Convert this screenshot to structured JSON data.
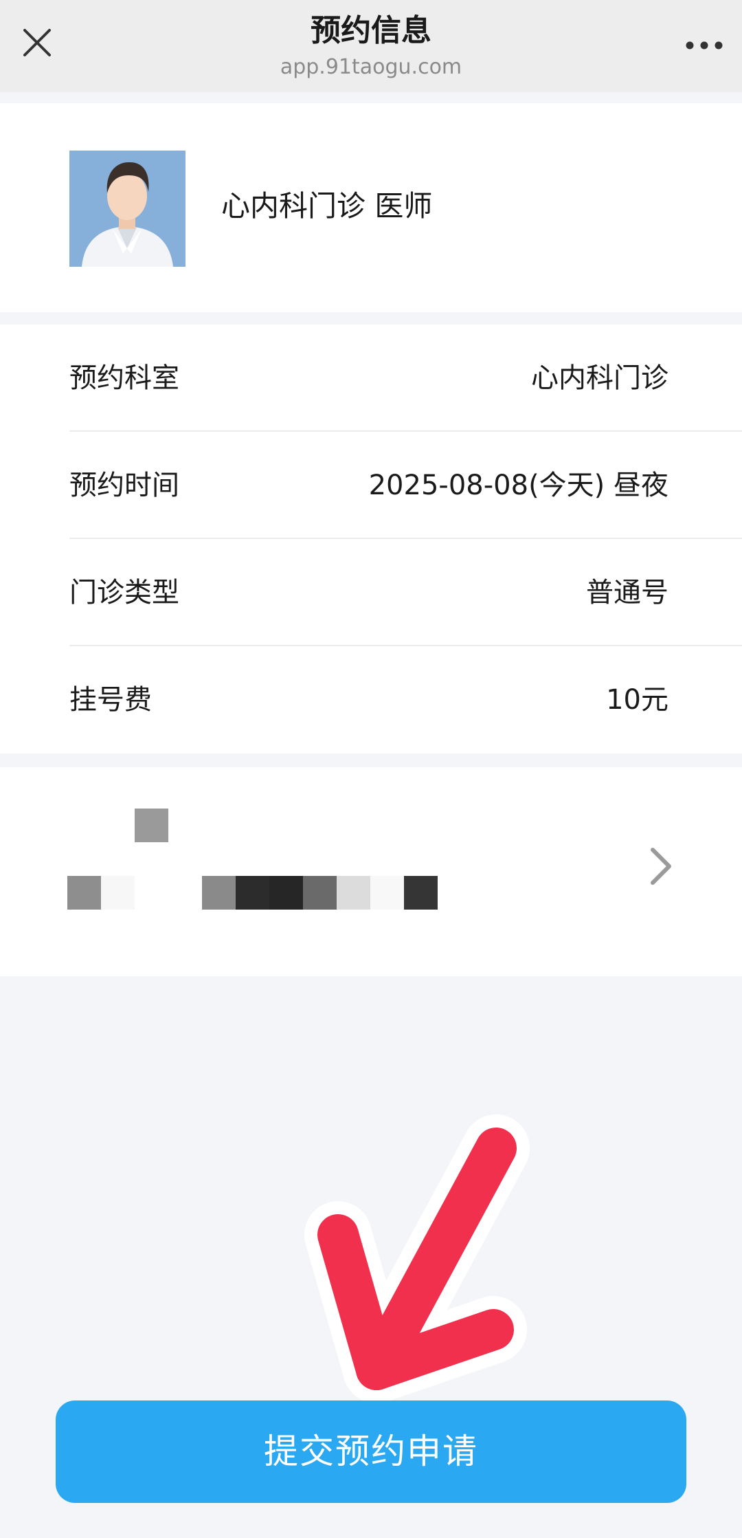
{
  "navbar": {
    "title": "预约信息",
    "url": "app.91taogu.com",
    "close_icon": "close-icon",
    "more_icon": "more-dots-icon"
  },
  "doctor": {
    "avatar_icon": "doctor-avatar",
    "name": "心内科门诊 医师"
  },
  "info": {
    "rows": [
      {
        "label": "预约科室",
        "value": "心内科门诊"
      },
      {
        "label": "预约时间",
        "value": "2025-08-08(今天) 昼夜"
      },
      {
        "label": "门诊类型",
        "value": "普通号"
      },
      {
        "label": "挂号费",
        "value": "10元"
      }
    ]
  },
  "patient": {
    "chevron_icon": "chevron-right-icon"
  },
  "submit": {
    "label": "提交预约申请"
  },
  "colors": {
    "accent": "#2aa8f2",
    "annotation_arrow": "#f1304d",
    "navbar_bg": "#ededed",
    "page_bg": "#f3f5f9"
  }
}
